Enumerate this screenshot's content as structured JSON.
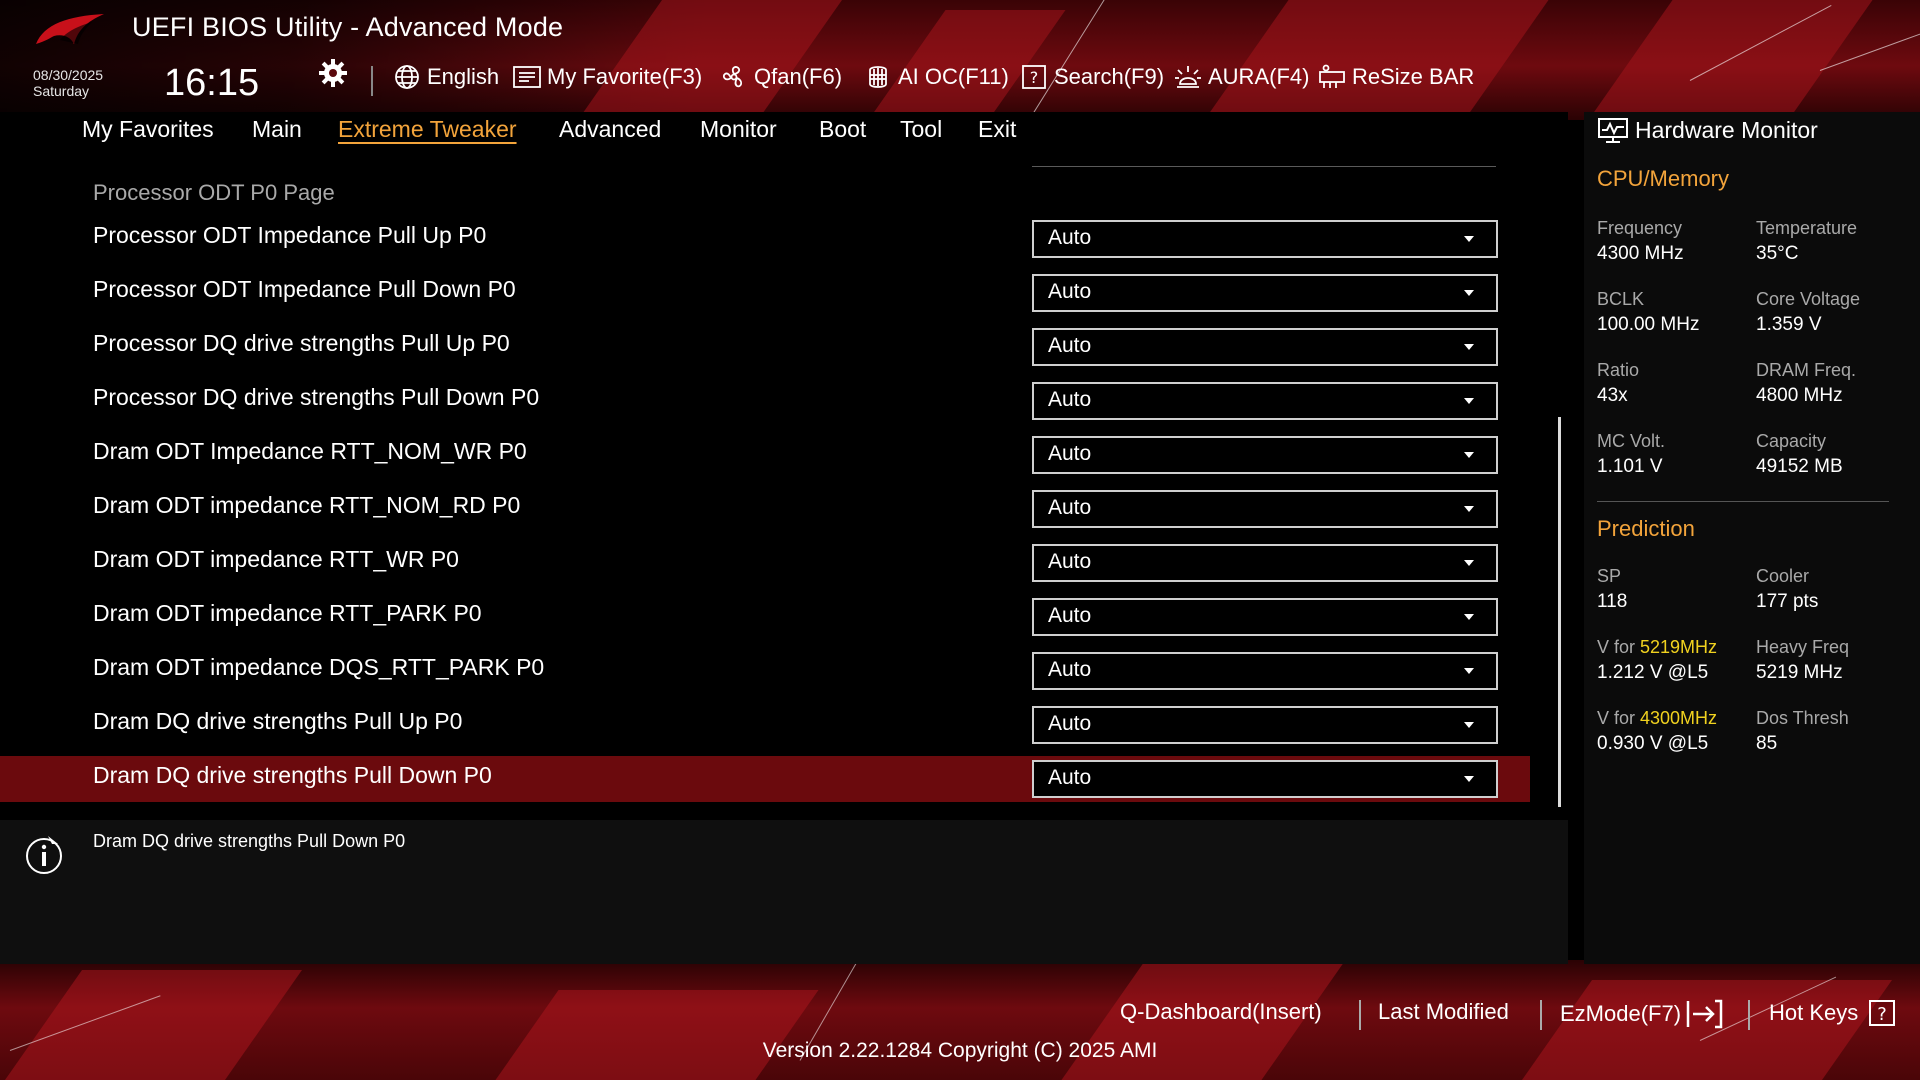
{
  "app": {
    "title": "UEFI BIOS Utility - Advanced Mode"
  },
  "datetime": {
    "date": "08/30/2025",
    "day": "Saturday",
    "time": "16:15"
  },
  "toolbar": [
    {
      "label": "English",
      "icon": "globe-icon"
    },
    {
      "label": "My Favorite(F3)",
      "icon": "favorite-list-icon"
    },
    {
      "label": "Qfan(F6)",
      "icon": "fan-icon"
    },
    {
      "label": "AI OC(F11)",
      "icon": "ai-chip-icon"
    },
    {
      "label": "Search(F9)",
      "icon": "search-icon"
    },
    {
      "label": "AURA(F4)",
      "icon": "aura-light-icon"
    },
    {
      "label": "ReSize BAR",
      "icon": "resize-bar-icon"
    }
  ],
  "nav": {
    "tabs": [
      "My Favorites",
      "Main",
      "Extreme Tweaker",
      "Advanced",
      "Monitor",
      "Boot",
      "Tool",
      "Exit"
    ],
    "active": "Extreme Tweaker"
  },
  "main": {
    "section": "Processor ODT P0 Page",
    "settings": [
      {
        "label": "Processor ODT Impedance Pull Up P0",
        "value": "Auto"
      },
      {
        "label": "Processor ODT Impedance Pull Down P0",
        "value": "Auto"
      },
      {
        "label": "Processor DQ drive strengths Pull Up P0",
        "value": "Auto"
      },
      {
        "label": "Processor DQ drive strengths Pull Down P0",
        "value": "Auto"
      },
      {
        "label": "Dram ODT Impedance RTT_NOM_WR P0",
        "value": "Auto"
      },
      {
        "label": "Dram ODT impedance RTT_NOM_RD P0",
        "value": "Auto"
      },
      {
        "label": "Dram ODT impedance RTT_WR P0",
        "value": "Auto"
      },
      {
        "label": "Dram ODT impedance RTT_PARK P0",
        "value": "Auto"
      },
      {
        "label": "Dram ODT impedance DQS_RTT_PARK P0",
        "value": "Auto"
      },
      {
        "label": "Dram DQ drive strengths Pull Up P0",
        "value": "Auto"
      },
      {
        "label": "Dram DQ drive strengths Pull Down P0",
        "value": "Auto"
      }
    ],
    "selected_index": 10
  },
  "help": {
    "text": "Dram DQ drive strengths Pull Down P0"
  },
  "hardware_monitor": {
    "title": "Hardware Monitor",
    "cpu_memory": {
      "heading": "CPU/Memory",
      "frequency_label": "Frequency",
      "frequency": "4300 MHz",
      "temperature_label": "Temperature",
      "temperature": "35°C",
      "bclk_label": "BCLK",
      "bclk": "100.00 MHz",
      "core_voltage_label": "Core Voltage",
      "core_voltage": "1.359 V",
      "ratio_label": "Ratio",
      "ratio": "43x",
      "dram_freq_label": "DRAM Freq.",
      "dram_freq": "4800 MHz",
      "mc_volt_label": "MC Volt.",
      "mc_volt": "1.101 V",
      "capacity_label": "Capacity",
      "capacity": "49152 MB"
    },
    "prediction": {
      "heading": "Prediction",
      "sp_label": "SP",
      "sp": "118",
      "cooler_label": "Cooler",
      "cooler": "177 pts",
      "v_for_prefix": "V for ",
      "v1_freq": "5219MHz",
      "v1_value": "1.212 V @L5",
      "heavy_freq_label": "Heavy Freq",
      "heavy_freq": "5219 MHz",
      "v2_freq": "4300MHz",
      "v2_value": "0.930 V @L5",
      "dos_thresh_label": "Dos Thresh",
      "dos_thresh": "85"
    }
  },
  "footer": {
    "qdashboard": "Q-Dashboard(Insert)",
    "last_modified": "Last Modified",
    "ezmode": "EzMode(F7)",
    "hotkeys": "Hot Keys",
    "version": "Version 2.22.1284 Copyright (C) 2025 AMI"
  },
  "colors": {
    "accent": "#f3a43b",
    "highlight": "#f1d21f",
    "selected_row": "#6b0a0d",
    "brand_red": "#c8101a"
  }
}
